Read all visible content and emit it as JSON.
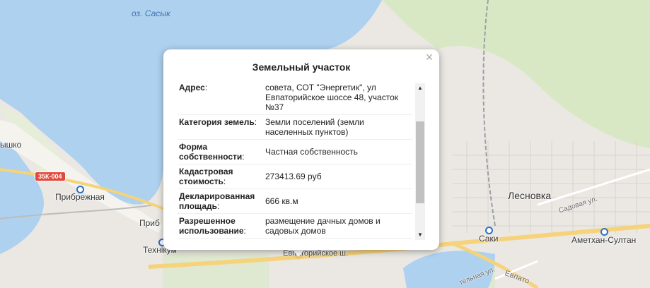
{
  "map": {
    "lake_label": "оз. Сасык",
    "places": {
      "pribrezhnaya": "Прибрежная",
      "pribrezhnoe_cut": "Приб",
      "tekhnikum": "Технікум",
      "saki": "Саки",
      "lesnovka": "Лесновка",
      "ametkhan": "Аметхан-Султан",
      "left_cut": "ышко"
    },
    "road_sign": "35К-004",
    "streets": {
      "evpatoria_sh": "Евпаторийское ш.",
      "sadovaya": "Садовая ул.",
      "evpat_cut": "Евпато",
      "vokzal_cut": "тельная ул."
    }
  },
  "popup": {
    "title": "Земельный участок",
    "close_symbol": "×",
    "rows": [
      {
        "label": "Адрес",
        "value": "совета, СОТ \"Энергетик\", ул Евпаторийское шоссе 48, участок №37"
      },
      {
        "label": "Категория земель",
        "value": "Земли поселений (земли населенных пунктов)"
      },
      {
        "label": "Форма собственности",
        "value": "Частная собственность"
      },
      {
        "label": "Кадастровая стоимость",
        "value": "273413.69 руб"
      },
      {
        "label": "Декларированная площадь",
        "value": "666 кв.м"
      },
      {
        "label": "Разрешенное использование",
        "value": "размещение дачных домов и садовых домов"
      }
    ],
    "scroll_up": "▲",
    "scroll_down": "▼"
  }
}
